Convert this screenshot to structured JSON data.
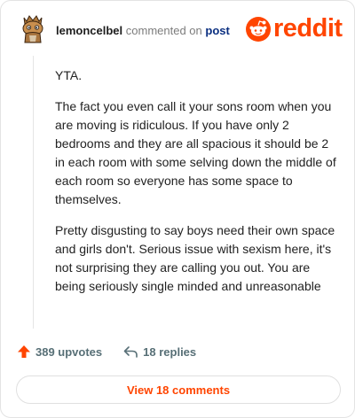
{
  "header": {
    "username": "lemoncelbel",
    "action_text": "commented on",
    "post_link": "post"
  },
  "logo": {
    "wordmark": "reddit",
    "color": "#ff4500"
  },
  "comment": {
    "paragraphs": [
      "YTA.",
      "The fact you even call it your sons room when you are moving is ridiculous. If you have only 2 bedrooms and they are all spacious it should be 2 in each room with some selving down the middle of each room so everyone has some space to themselves.",
      "Pretty disgusting to say boys need their own space and girls don't. Serious issue with sexism here, it's not surprising they are calling you out. You are being seriously single minded and unreasonable"
    ]
  },
  "actions": {
    "upvotes": "389 upvotes",
    "replies": "18 replies",
    "upvote_icon": "arrow-up-icon",
    "reply_icon": "reply-arrow-icon"
  },
  "footer": {
    "view_comments": "View 18 comments"
  },
  "colors": {
    "brand": "#ff4500",
    "username": "#1c1c1c",
    "link": "#0a2f80",
    "muted": "#576f76"
  }
}
